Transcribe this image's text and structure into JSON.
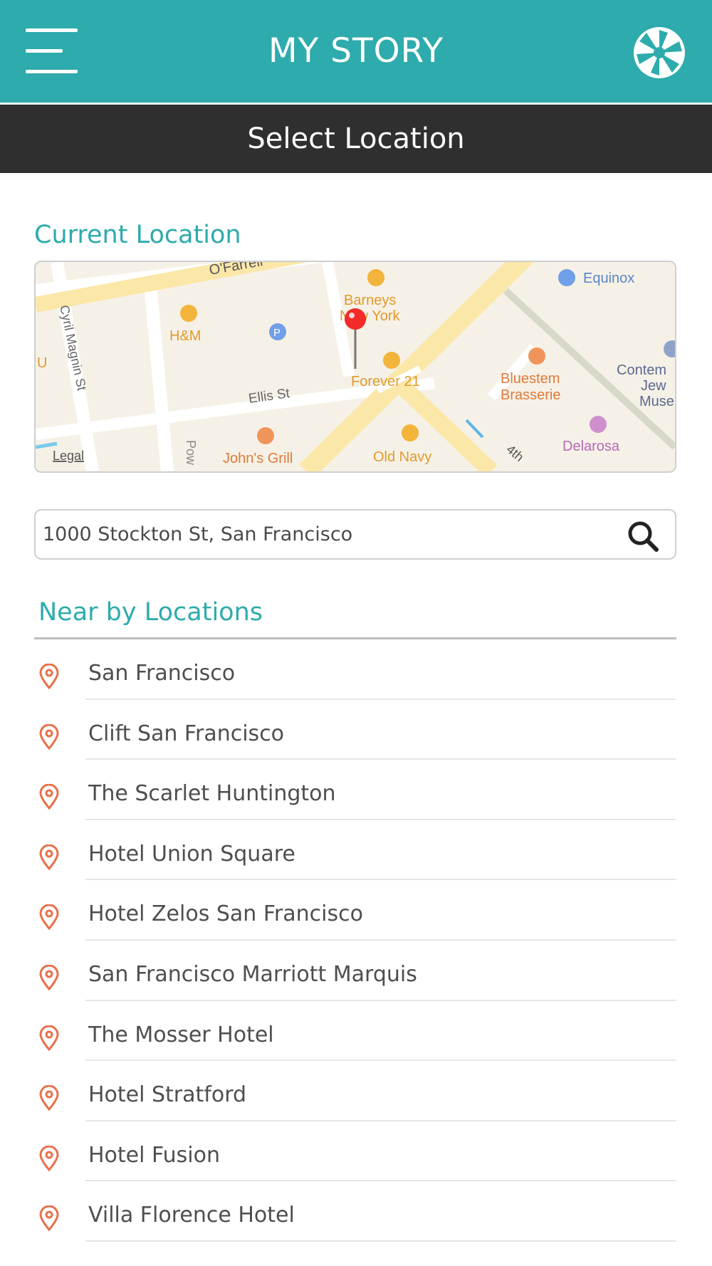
{
  "header": {
    "title": "MY STORY",
    "menu_icon": "hamburger-menu-icon",
    "camera_icon": "camera-shutter-icon"
  },
  "subheader": {
    "title": "Select Location"
  },
  "current_location": {
    "heading": "Current Location",
    "map": {
      "labels": {
        "ofarrell": "O'Farrell",
        "cyril": "Cyril Magnin St",
        "hm": "H&M",
        "barneys1": "Barneys",
        "barneys2": "New York",
        "forever21": "Forever 21",
        "ellis": "Ellis St",
        "johns": "John's Grill",
        "oldnavy": "Old Navy",
        "bluestem1": "Bluestem",
        "bluestem2": "Brasserie",
        "equinox": "Equinox",
        "contem1": "Contem",
        "contem2": "Jew",
        "contem3": "Muse",
        "delarosa": "Delarosa",
        "fourth": "4th",
        "powell": "Pow",
        "u": "U",
        "legal": "Legal"
      }
    }
  },
  "search": {
    "value": "1000 Stockton St, San Francisco",
    "icon": "search-icon"
  },
  "nearby": {
    "heading": "Near by Locations",
    "items": [
      {
        "label": "San Francisco"
      },
      {
        "label": "Clift San Francisco"
      },
      {
        "label": "The Scarlet Huntington"
      },
      {
        "label": "Hotel Union Square"
      },
      {
        "label": "Hotel Zelos San Francisco"
      },
      {
        "label": "San Francisco Marriott Marquis"
      },
      {
        "label": "The Mosser Hotel"
      },
      {
        "label": "Hotel Stratford"
      },
      {
        "label": "Hotel Fusion"
      },
      {
        "label": "Villa Florence Hotel"
      }
    ]
  },
  "colors": {
    "accent": "#2eabac",
    "subheader_bg": "#2f2f2f",
    "pin": "#e8704a"
  }
}
